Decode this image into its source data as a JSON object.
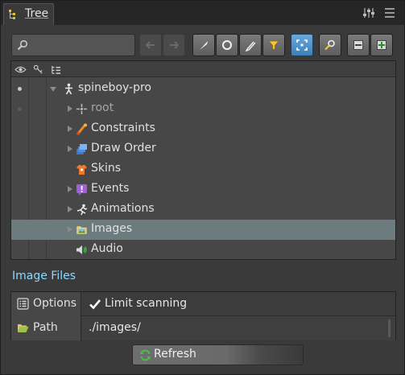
{
  "panel": {
    "tab_title": "Tree",
    "menu_icons": [
      "sliders-icon",
      "menu-icon"
    ]
  },
  "toolbar": {
    "search": {
      "value": "",
      "placeholder": ""
    },
    "buttons": [
      {
        "name": "back-button",
        "icon": "arrow-left-icon",
        "enabled": false
      },
      {
        "name": "forward-button",
        "icon": "arrow-right-icon",
        "enabled": false
      },
      {
        "name": "bone-filter-button",
        "icon": "bone-icon",
        "enabled": true
      },
      {
        "name": "circle-filter-button",
        "icon": "circle-icon",
        "enabled": true
      },
      {
        "name": "pencil-filter-button",
        "icon": "pencil-icon",
        "enabled": true
      },
      {
        "name": "funnel-filter-button",
        "icon": "funnel-icon",
        "enabled": true
      },
      {
        "name": "focus-button",
        "icon": "focus-icon",
        "enabled": true,
        "active": true
      },
      {
        "name": "find-button",
        "icon": "magnifier-key-icon",
        "enabled": true
      },
      {
        "name": "collapse-button",
        "icon": "collapse-icon",
        "enabled": true
      },
      {
        "name": "expand-button",
        "icon": "expand-icon",
        "enabled": true
      }
    ]
  },
  "tree": {
    "header_icons": [
      "eye-icon",
      "bone-key-icon",
      "tree-list-icon"
    ],
    "rows": [
      {
        "label": "spineboy-pro",
        "icon": "skeleton-icon",
        "expanded": true,
        "has_arrow": true,
        "depth": 0,
        "visible_dot": true
      },
      {
        "label": "root",
        "icon": "bone-root-icon",
        "expanded": false,
        "has_arrow": true,
        "depth": 1,
        "muted": true,
        "visible_dot": false
      },
      {
        "label": "Constraints",
        "icon": "constraint-icon",
        "expanded": false,
        "has_arrow": true,
        "depth": 1
      },
      {
        "label": "Draw Order",
        "icon": "draw-order-icon",
        "expanded": false,
        "has_arrow": true,
        "depth": 1
      },
      {
        "label": "Skins",
        "icon": "skins-icon",
        "expanded": false,
        "has_arrow": false,
        "depth": 1
      },
      {
        "label": "Events",
        "icon": "events-icon",
        "expanded": false,
        "has_arrow": true,
        "depth": 1
      },
      {
        "label": "Animations",
        "icon": "animations-icon",
        "expanded": false,
        "has_arrow": true,
        "depth": 1
      },
      {
        "label": "Images",
        "icon": "images-folder-icon",
        "expanded": false,
        "has_arrow": true,
        "depth": 1,
        "selected": true
      },
      {
        "label": "Audio",
        "icon": "audio-icon",
        "expanded": false,
        "has_arrow": false,
        "depth": 1
      }
    ]
  },
  "section": {
    "title": "Image Files"
  },
  "properties": {
    "options": {
      "label": "Options",
      "checkbox_label": "Limit scanning",
      "checked": true
    },
    "path": {
      "label": "Path",
      "value": "./images/"
    }
  },
  "refresh": {
    "label": "Refresh"
  },
  "colors": {
    "accent_text": "#8fd6ff",
    "selected_row": "#6c7b7e",
    "active_button": "#4d8fc8"
  }
}
